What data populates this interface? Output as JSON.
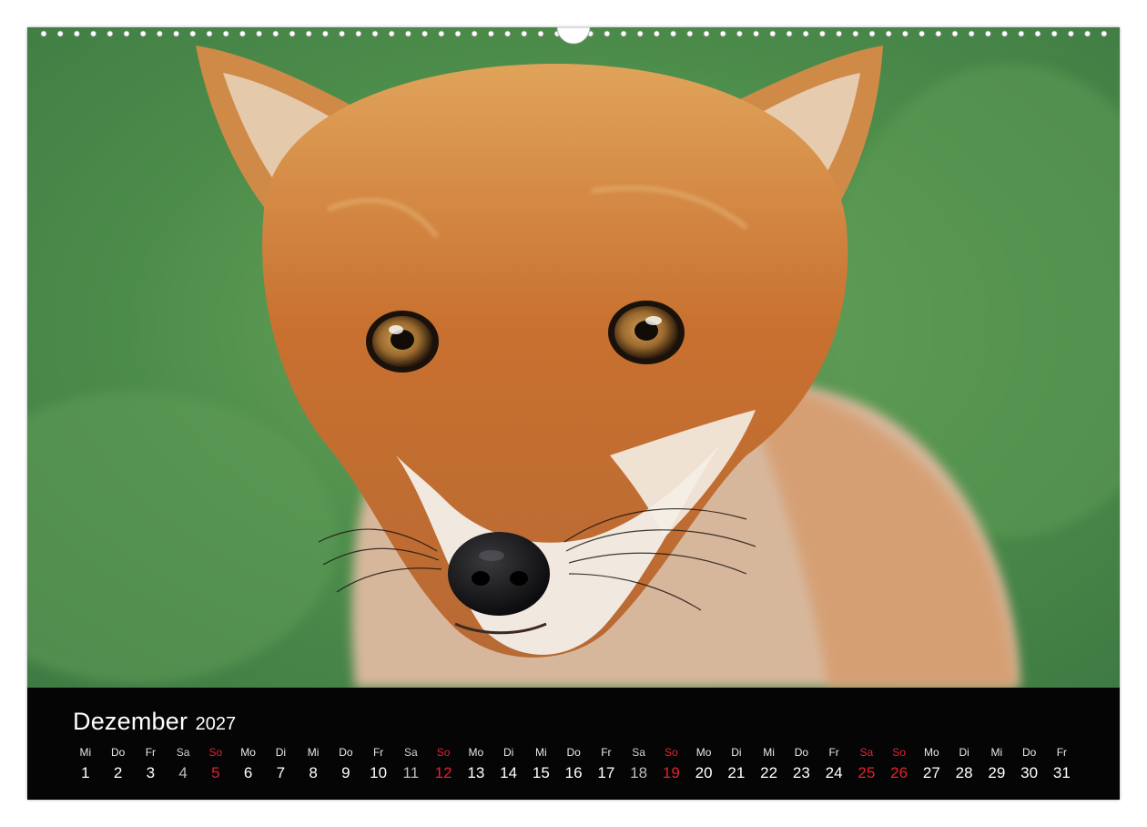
{
  "calendar": {
    "month": "Dezember",
    "year": "2027"
  },
  "photo": {
    "subject": "fox-portrait"
  },
  "colors": {
    "sunday": "#e0232f",
    "saturday": "#bdbdbd",
    "background_strip": "#050505",
    "grass": "#4f8f4c",
    "fur": "#c8702f"
  },
  "days": [
    {
      "wd": "Mi",
      "d": "1",
      "type": "weekday"
    },
    {
      "wd": "Do",
      "d": "2",
      "type": "weekday"
    },
    {
      "wd": "Fr",
      "d": "3",
      "type": "weekday"
    },
    {
      "wd": "Sa",
      "d": "4",
      "type": "sat"
    },
    {
      "wd": "So",
      "d": "5",
      "type": "sun"
    },
    {
      "wd": "Mo",
      "d": "6",
      "type": "weekday"
    },
    {
      "wd": "Di",
      "d": "7",
      "type": "weekday"
    },
    {
      "wd": "Mi",
      "d": "8",
      "type": "weekday"
    },
    {
      "wd": "Do",
      "d": "9",
      "type": "weekday"
    },
    {
      "wd": "Fr",
      "d": "10",
      "type": "weekday"
    },
    {
      "wd": "Sa",
      "d": "11",
      "type": "sat"
    },
    {
      "wd": "So",
      "d": "12",
      "type": "sun"
    },
    {
      "wd": "Mo",
      "d": "13",
      "type": "weekday"
    },
    {
      "wd": "Di",
      "d": "14",
      "type": "weekday"
    },
    {
      "wd": "Mi",
      "d": "15",
      "type": "weekday"
    },
    {
      "wd": "Do",
      "d": "16",
      "type": "weekday"
    },
    {
      "wd": "Fr",
      "d": "17",
      "type": "weekday"
    },
    {
      "wd": "Sa",
      "d": "18",
      "type": "sat"
    },
    {
      "wd": "So",
      "d": "19",
      "type": "sun"
    },
    {
      "wd": "Mo",
      "d": "20",
      "type": "weekday"
    },
    {
      "wd": "Di",
      "d": "21",
      "type": "weekday"
    },
    {
      "wd": "Mi",
      "d": "22",
      "type": "weekday"
    },
    {
      "wd": "Do",
      "d": "23",
      "type": "weekday"
    },
    {
      "wd": "Fr",
      "d": "24",
      "type": "weekday"
    },
    {
      "wd": "Sa",
      "d": "25",
      "type": "holiday"
    },
    {
      "wd": "So",
      "d": "26",
      "type": "sun"
    },
    {
      "wd": "Mo",
      "d": "27",
      "type": "weekday"
    },
    {
      "wd": "Di",
      "d": "28",
      "type": "weekday"
    },
    {
      "wd": "Mi",
      "d": "29",
      "type": "weekday"
    },
    {
      "wd": "Do",
      "d": "30",
      "type": "weekday"
    },
    {
      "wd": "Fr",
      "d": "31",
      "type": "weekday"
    }
  ]
}
